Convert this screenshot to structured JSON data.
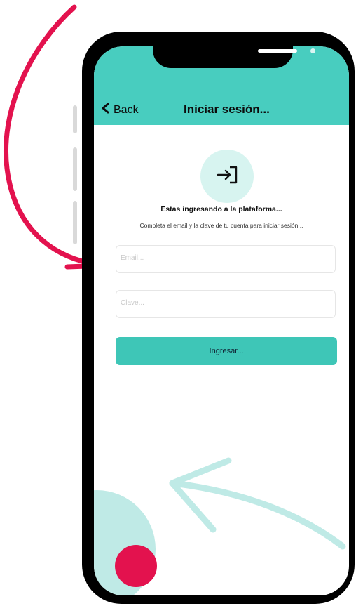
{
  "header": {
    "back_label": "Back",
    "title": "Iniciar sesión..."
  },
  "content": {
    "heading": "Estas ingresando a la plataforma...",
    "subtitle": "Completa el email y la clave de tu cuenta para iniciar sesión..."
  },
  "form": {
    "email_placeholder": "Email...",
    "password_placeholder": "Clave...",
    "submit_label": "Ingresar..."
  },
  "colors": {
    "accent": "#48cdbf",
    "button": "#3ec6b7",
    "arrow": "#e3124e",
    "deco": "#bfeae6"
  }
}
